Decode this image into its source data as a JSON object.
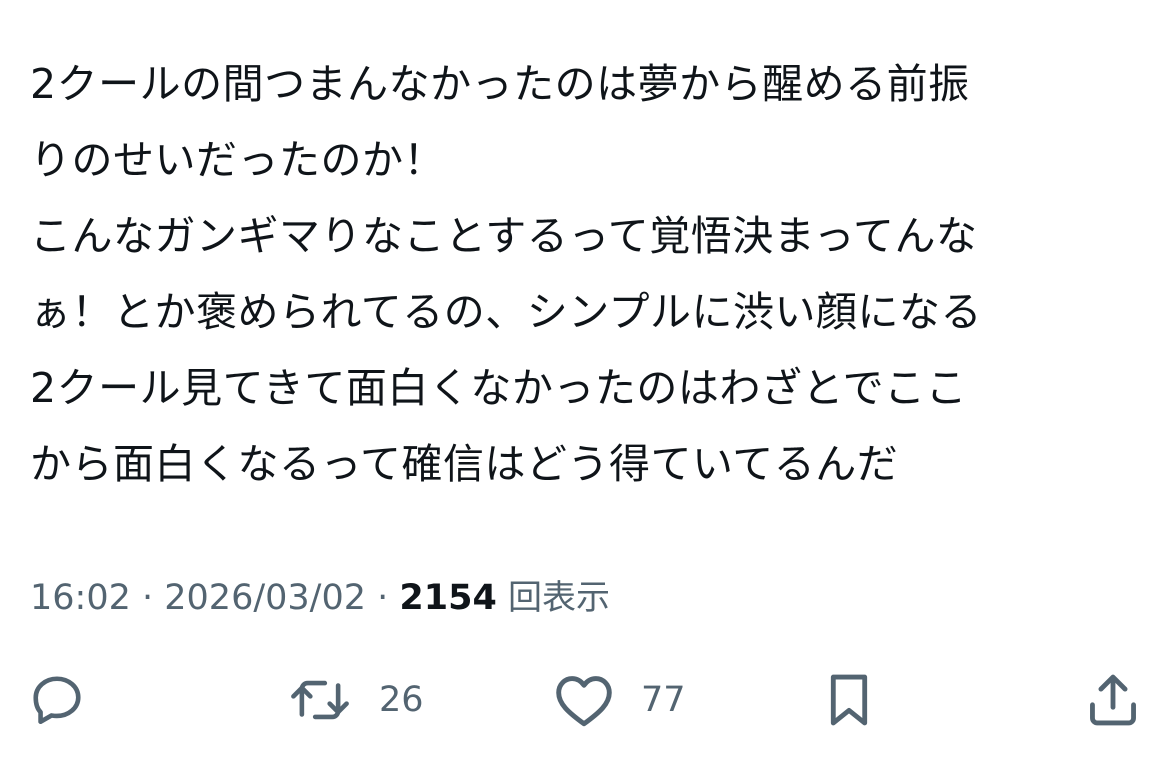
{
  "tweet": {
    "lines": [
      "2クールの間つまんなかったのは夢から醒める前振",
      "りのせいだったのか！",
      "こんなガンギマりなことするって覚悟決まってんな",
      "ぁ！とか褒められてるの、シンプルに渋い顔になる",
      "2クール見てきて面白くなかったのはわざとでここ",
      "から面白くなるって確信はどう得ていてるんだ"
    ]
  },
  "meta": {
    "time": "16:02",
    "separator": " · ",
    "date": "2026/03/02",
    "views_count": "2154",
    "views_label": "回表示"
  },
  "actions": {
    "reply": {
      "icon": "reply-icon"
    },
    "retweet": {
      "icon": "retweet-icon",
      "count": "26"
    },
    "like": {
      "icon": "heart-icon",
      "count": "77"
    },
    "bookmark": {
      "icon": "bookmark-icon"
    },
    "share": {
      "icon": "share-icon"
    }
  },
  "colors": {
    "text": "#0f1419",
    "secondary": "#536471",
    "background": "#ffffff"
  }
}
